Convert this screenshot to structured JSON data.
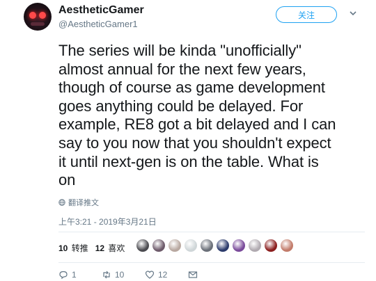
{
  "user": {
    "name": "AestheticGamer",
    "handle": "@AestheticGamer1"
  },
  "follow_label": "关注",
  "tweet_lines": [
    "The series will be kinda \"unofficially\"",
    "almost annual for the next few years,",
    "though of course as game development",
    "goes anything could be delayed. For",
    "example, RE8 got a bit delayed and I can",
    "say to you now that you shouldn't expect",
    "it until next-gen is on the table. What is",
    "on"
  ],
  "translate_label": "翻译推文",
  "timestamp": "上午3:21 - 2019年3月21日",
  "stats": {
    "retweets_count": "10",
    "retweets_label": "转推",
    "likes_count": "12",
    "likes_label": "喜欢"
  },
  "actions": {
    "reply_count": "1",
    "retweet_count": "10",
    "like_count": "12"
  },
  "colors": {
    "accent": "#1da1f2",
    "text": "#14171a",
    "muted": "#657786",
    "divider": "#e6ecf0"
  },
  "likers": [
    "#4a4a4f",
    "#6d5a6a",
    "#b8a8a0",
    "#cfd6d8",
    "#6a6f78",
    "#2b3a6b",
    "#7a4a9a",
    "#b0aab0",
    "#8b1e1e",
    "#c27b6a"
  ]
}
